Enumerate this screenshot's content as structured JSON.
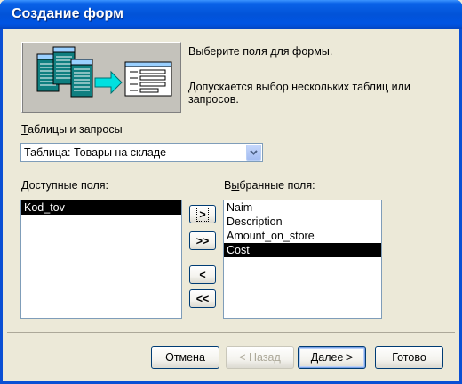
{
  "window": {
    "title": "Создание форм"
  },
  "intro": {
    "line1": "Выберите поля для формы.",
    "line2": "Допускается выбор нескольких таблиц или запросов."
  },
  "source": {
    "label_ul": "Т",
    "label_rest": "аблицы и запросы",
    "selected": "Таблица: Товары на складе"
  },
  "available": {
    "label_ul": "Д",
    "label_rest": "оступные поля:",
    "items": [
      {
        "text": "Kod_tov",
        "selected": true
      }
    ]
  },
  "selected_fields": {
    "label_pre": "В",
    "label_ul": "ы",
    "label_rest": "бранные поля:",
    "items": [
      {
        "text": "Naim",
        "selected": false
      },
      {
        "text": "Description",
        "selected": false
      },
      {
        "text": "Amount_on_store",
        "selected": false
      },
      {
        "text": "Cost",
        "selected": true
      }
    ]
  },
  "move_buttons": {
    "add_one": ">",
    "add_all": ">>",
    "remove_one": "<",
    "remove_all": "<<"
  },
  "footer": {
    "cancel": "Отмена",
    "back": "< Назад",
    "next_ul": "Д",
    "next_rest": "алее >",
    "finish": "Готово"
  },
  "colors": {
    "titlebar": "#0054e3",
    "selection": "#000000",
    "face": "#ece9d8"
  }
}
